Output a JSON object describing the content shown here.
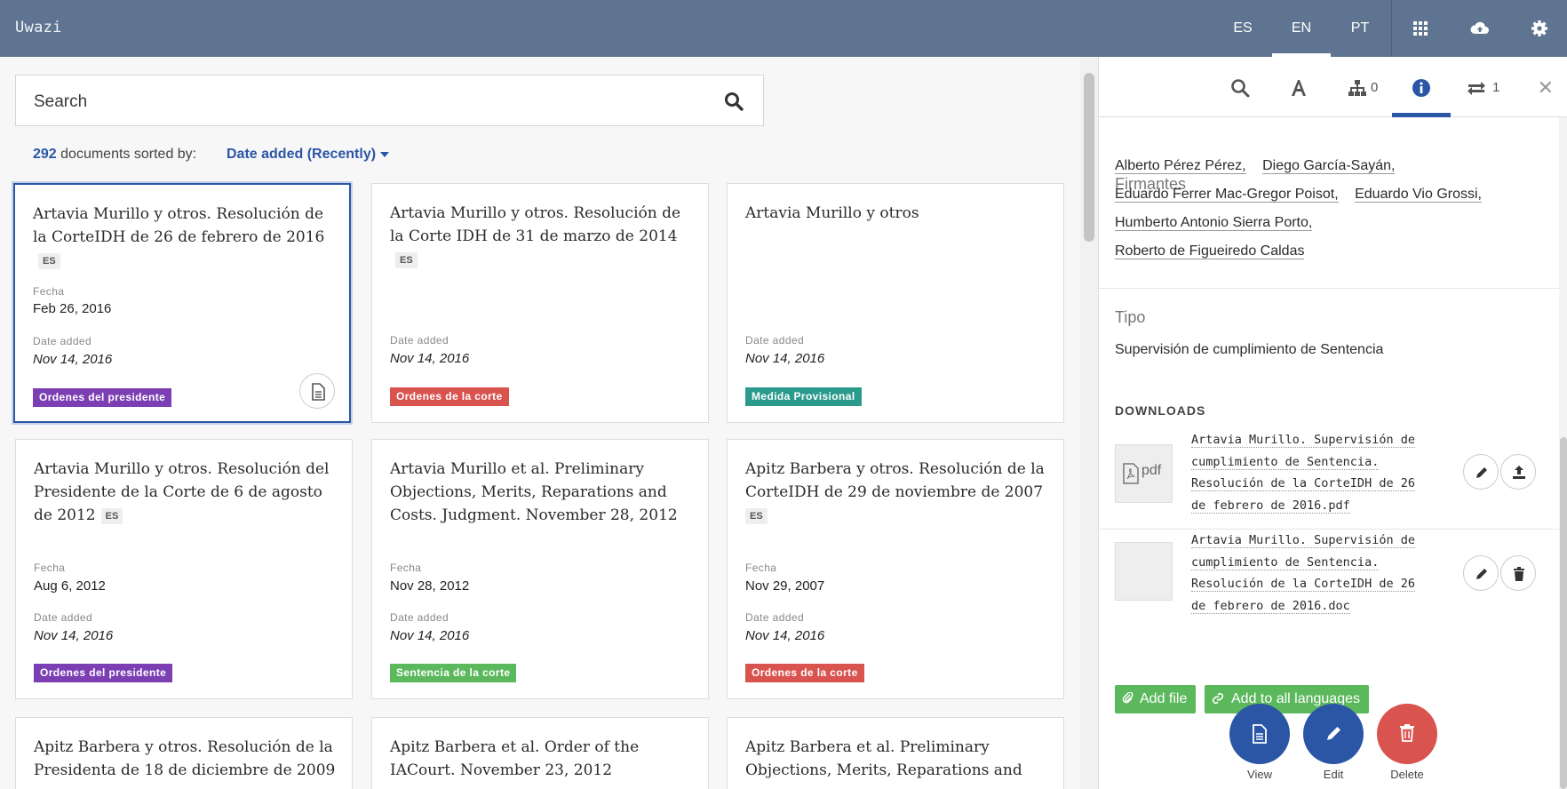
{
  "app": {
    "title": "Uwazi"
  },
  "topbar": {
    "languages": [
      "ES",
      "EN",
      "PT"
    ],
    "active_language": "EN",
    "icons": [
      "grid-icon",
      "cloud-upload-icon",
      "gear-icon"
    ]
  },
  "search": {
    "placeholder": "Search"
  },
  "results": {
    "count": "292",
    "sorted_by_label": "documents sorted by:",
    "sort_value": "Date added (Recently)"
  },
  "cards": [
    {
      "title": "Artavia Murillo y otros. Resolución de la CorteIDH de 26 de febrero de 2016",
      "lang": "ES",
      "fecha_label": "Fecha",
      "fecha": "Feb 26, 2016",
      "added_label": "Date added",
      "added": "Nov 14, 2016",
      "tag": "Ordenes del presidente",
      "tag_color": "#7b3fb3"
    },
    {
      "title": "Artavia Murillo y otros. Resolución de la Corte IDH de 31 de marzo de 2014",
      "lang": "ES",
      "added_label": "Date added",
      "added": "Nov 14, 2016",
      "tag": "Ordenes de la corte",
      "tag_color": "#d9534f"
    },
    {
      "title": "Artavia Murillo y otros",
      "added_label": "Date added",
      "added": "Nov 14, 2016",
      "tag": "Medida Provisional",
      "tag_color": "#2a9a8c"
    },
    {
      "title": "Artavia Murillo y otros. Resolución del Presidente de la Corte de 6 de agosto de 2012",
      "lang": "ES",
      "fecha_label": "Fecha",
      "fecha": "Aug 6, 2012",
      "added_label": "Date added",
      "added": "Nov 14, 2016",
      "tag": "Ordenes del presidente",
      "tag_color": "#7b3fb3"
    },
    {
      "title": "Artavia Murillo et al. Preliminary Objections, Merits, Reparations and Costs. Judgment. November 28, 2012",
      "fecha_label": "Fecha",
      "fecha": "Nov 28, 2012",
      "added_label": "Date added",
      "added": "Nov 14, 2016",
      "tag": "Sentencia de la corte",
      "tag_color": "#5cb85c"
    },
    {
      "title": "Apitz Barbera y otros. Resolución de la CorteIDH de 29 de noviembre de 2007",
      "lang": "ES",
      "fecha_label": "Fecha",
      "fecha": "Nov 29, 2007",
      "added_label": "Date added",
      "added": "Nov 14, 2016",
      "tag": "Ordenes de la corte",
      "tag_color": "#d9534f"
    },
    {
      "title": "Apitz Barbera y otros. Resolución de la Presidenta de 18 de diciembre de 2009"
    },
    {
      "title": "Apitz Barbera et al. Order of the IACourt. November 23, 2012"
    },
    {
      "title": "Apitz Barbera et al. Preliminary Objections, Merits, Reparations and"
    }
  ],
  "sidepanel": {
    "tabs": {
      "connections_count": "0",
      "references_count": "1"
    },
    "firmantes_label": "Firmantes",
    "firmantes": [
      "Alberto Pérez Pérez,",
      "Diego García-Sayán,",
      "Eduardo Ferrer Mac-Gregor Poisot,",
      "Eduardo Vio Grossi,",
      "Humberto Antonio Sierra Porto,",
      "Roberto de Figueiredo Caldas"
    ],
    "tipo_label": "Tipo",
    "tipo_value": "Supervisión de cumplimiento de Sentencia",
    "downloads_label": "DOWNLOADS",
    "files": [
      {
        "name": "Artavia Murillo. Supervisión de cumplimiento de Sentencia. Resolución de la CorteIDH de 26 de febrero de 2016.pdf",
        "thumb": "pdf"
      },
      {
        "name": "Artavia Murillo. Supervisión de cumplimiento de Sentencia. Resolución de la CorteIDH de 26 de febrero de 2016.doc",
        "thumb": ""
      }
    ],
    "add_file": "Add file",
    "add_all_languages": "Add to all languages",
    "actions": {
      "view": "View",
      "edit": "Edit",
      "delete": "Delete"
    }
  }
}
